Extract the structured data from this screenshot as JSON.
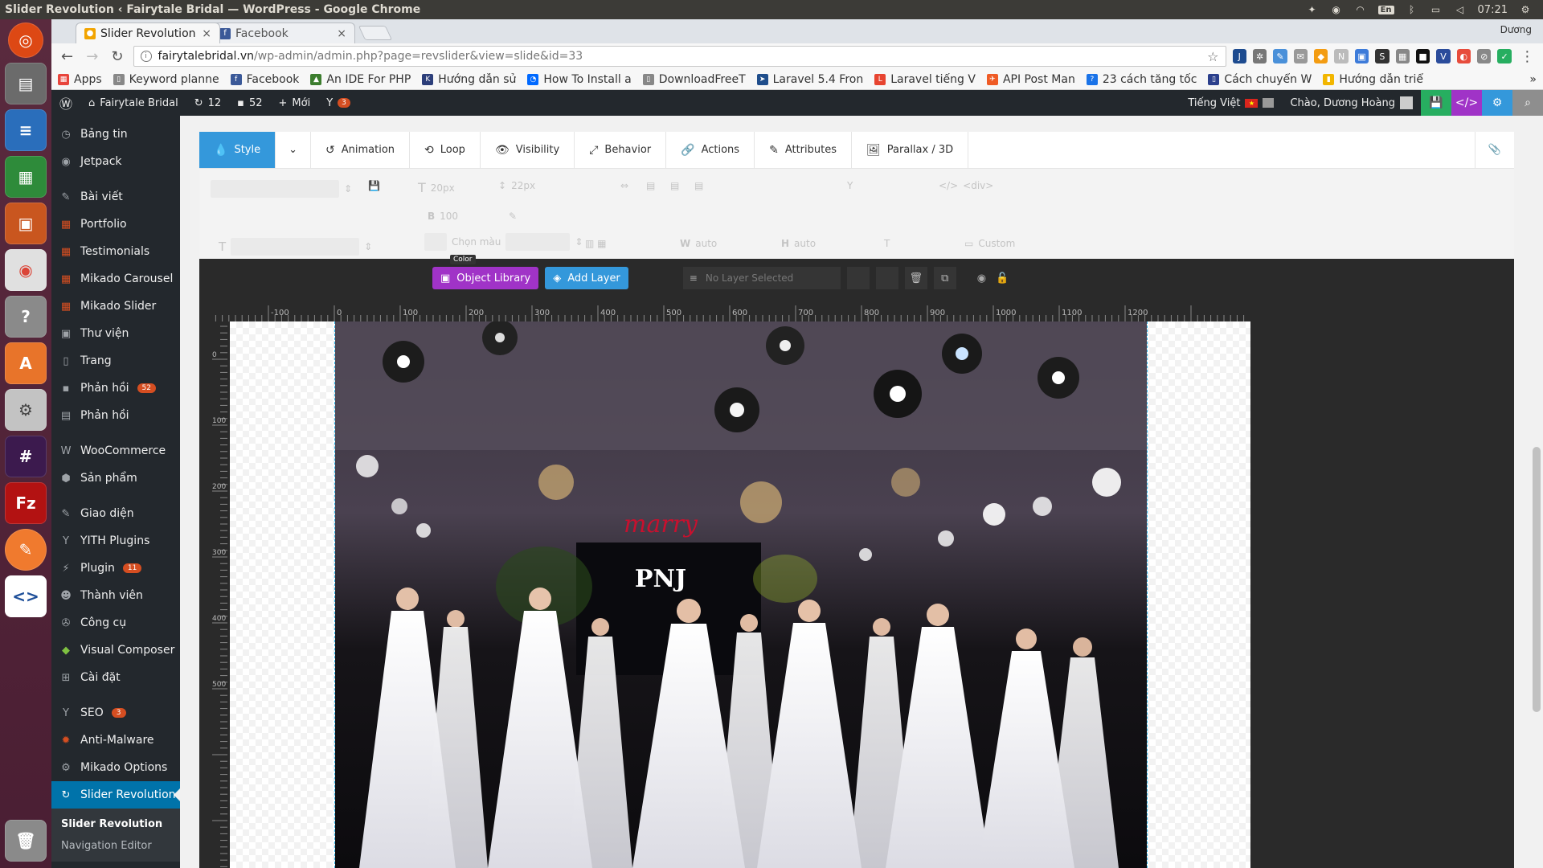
{
  "os": {
    "window_title": "Slider Revolution ‹ Fairytale Bridal — WordPress - Google Chrome",
    "clock": "07:21",
    "keyboard_lang": "En"
  },
  "browser": {
    "tabs": [
      {
        "label": "Slider Revolution ‹ F",
        "close": "×"
      },
      {
        "label": "Facebook",
        "close": "×"
      }
    ],
    "profile": "Dương",
    "url_host": "fairytalebridal.vn",
    "url_path": "/wp-admin/admin.php?page=revslider&view=slide&id=33",
    "bookmarks": [
      {
        "label": "Apps",
        "icon": "apps-grid-icon",
        "color": "#e8453c"
      },
      {
        "label": "Keyword planne",
        "icon": "page-icon",
        "color": "#888888"
      },
      {
        "label": "Facebook",
        "icon": "facebook-icon",
        "color": "#3b5998"
      },
      {
        "label": "An IDE For PHP",
        "icon": "ide-icon",
        "color": "#3c7d2e"
      },
      {
        "label": "Hướng dẫn sử",
        "icon": "k-icon",
        "color": "#2c3e7a"
      },
      {
        "label": "How To Install a",
        "icon": "digitalocean-icon",
        "color": "#0069ff"
      },
      {
        "label": "DownloadFreeT",
        "icon": "page-icon",
        "color": "#888888"
      },
      {
        "label": "Laravel 5.4 Fron",
        "icon": "send-icon",
        "color": "#1f4e8c"
      },
      {
        "label": "Laravel tiếng V",
        "icon": "laravel-icon",
        "color": "#e74430"
      },
      {
        "label": "API Post Man",
        "icon": "postman-icon",
        "color": "#ef5b25"
      },
      {
        "label": "23 cách tăng tốc",
        "icon": "question-icon",
        "color": "#1a73e8"
      },
      {
        "label": "Cách chuyển W",
        "icon": "page-blue-icon",
        "color": "#2b3f8c"
      },
      {
        "label": "Hướng dẫn triể",
        "icon": "bookmark-yellow-icon",
        "color": "#f2b600"
      }
    ],
    "more": "»"
  },
  "adminbar": {
    "site_name": "Fairytale Bridal",
    "updates": "12",
    "comments": "52",
    "new_label": "Mới",
    "yoast_count": "3",
    "language": "Tiếng Việt",
    "greeting": "Chào, Dương Hoàng"
  },
  "menu": {
    "items": [
      {
        "label": "Bảng tin",
        "icon": "dashboard-icon"
      },
      {
        "label": "Jetpack",
        "icon": "jetpack-icon"
      },
      {
        "label": "Bài viết",
        "icon": "pin-icon"
      },
      {
        "label": "Portfolio",
        "icon": "grid-icon"
      },
      {
        "label": "Testimonials",
        "icon": "grid-icon"
      },
      {
        "label": "Mikado Carousel",
        "icon": "grid-icon"
      },
      {
        "label": "Mikado Slider",
        "icon": "grid-icon"
      },
      {
        "label": "Thư viện",
        "icon": "media-icon"
      },
      {
        "label": "Trang",
        "icon": "page-icon"
      },
      {
        "label": "Phản hồi",
        "icon": "comment-icon",
        "count": "52"
      },
      {
        "label": "Phản hồi",
        "icon": "feedback-icon"
      },
      {
        "label": "WooCommerce",
        "icon": "woo-icon"
      },
      {
        "label": "Sản phẩm",
        "icon": "product-icon"
      },
      {
        "label": "Giao diện",
        "icon": "brush-icon"
      },
      {
        "label": "YITH Plugins",
        "icon": "yith-icon"
      },
      {
        "label": "Plugin",
        "icon": "plugin-icon",
        "count": "11"
      },
      {
        "label": "Thành viên",
        "icon": "user-icon"
      },
      {
        "label": "Công cụ",
        "icon": "wrench-icon"
      },
      {
        "label": "Visual Composer",
        "icon": "vc-icon"
      },
      {
        "label": "Cài đặt",
        "icon": "settings-icon"
      },
      {
        "label": "SEO",
        "icon": "yoast-icon",
        "count": "3"
      },
      {
        "label": "Anti-Malware",
        "icon": "malware-icon"
      },
      {
        "label": "Mikado Options",
        "icon": "gear-icon"
      },
      {
        "label": "Slider Revolution",
        "icon": "revslider-icon"
      }
    ],
    "submenu": [
      {
        "label": "Slider Revolution"
      },
      {
        "label": "Navigation Editor"
      }
    ]
  },
  "editor": {
    "tabs": [
      {
        "label": "Style",
        "icon": "drop-icon",
        "symbol": "💧"
      },
      {
        "label": "Animation",
        "icon": "history-icon",
        "symbol": "↺"
      },
      {
        "label": "Loop",
        "icon": "loop-icon",
        "symbol": "⟲"
      },
      {
        "label": "Visibility",
        "icon": "eye-icon",
        "symbol": "👁"
      },
      {
        "label": "Behavior",
        "icon": "behavior-icon",
        "symbol": "⤢"
      },
      {
        "label": "Actions",
        "icon": "link-icon",
        "symbol": "🔗"
      },
      {
        "label": "Attributes",
        "icon": "tools-icon",
        "symbol": "✎"
      },
      {
        "label": "Parallax / 3D",
        "icon": "image-icon",
        "symbol": "🖼"
      }
    ],
    "style_panel": {
      "font_size": "20px",
      "line_height": "22px",
      "font_weight": "100",
      "color_placeholder": "Chọn màu",
      "tag": "<div>",
      "width": "auto",
      "height": "auto",
      "custom": "Custom",
      "tooltip": "Color"
    },
    "object_library_label": "Object Library",
    "add_layer_label": "Add Layer",
    "no_layer_label": "No Layer Selected",
    "ruler_labels_h": [
      "-100",
      "0",
      "100",
      "200",
      "300",
      "400",
      "500",
      "600",
      "700",
      "800",
      "900",
      "1000",
      "1100",
      "1200"
    ],
    "ruler_labels_v": [
      "0",
      "100",
      "200",
      "300",
      "400",
      "500"
    ],
    "slide_marks": [
      "marry",
      "PNJ"
    ]
  }
}
